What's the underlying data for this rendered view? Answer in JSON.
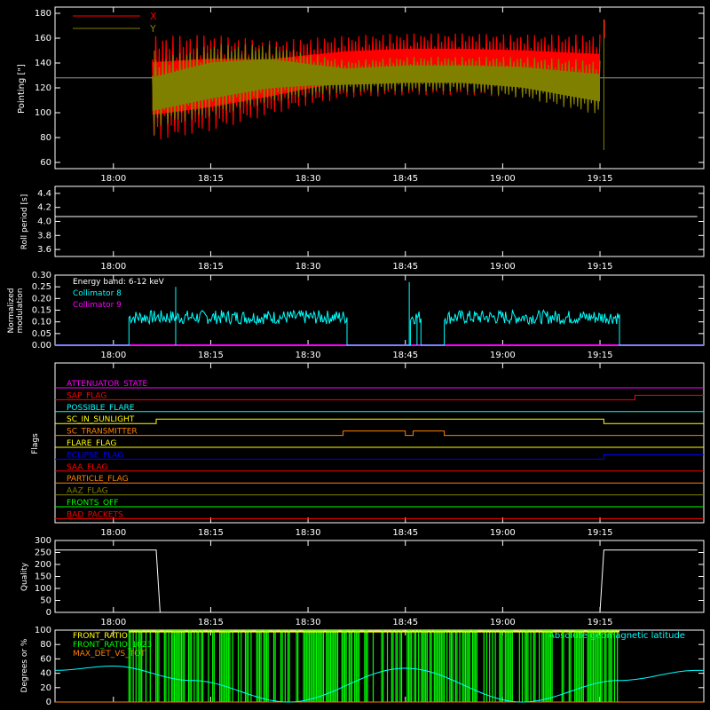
{
  "colors": {
    "background": "#000000",
    "axis": "#ffffff",
    "x_series": "#ff0000",
    "y_series": "#808000",
    "cyan": "#00ffff",
    "magenta": "#ff00ff",
    "green": "#00ff00",
    "orange": "#ff8000",
    "yellow": "#ffff00",
    "blue": "#0000ff",
    "red": "#ff0000",
    "olive": "#808000"
  },
  "chart_data": [
    {
      "id": "pointing",
      "type": "line",
      "ylabel": "Pointing [\"]",
      "ylim": [
        55,
        185
      ],
      "yticks": [
        60,
        80,
        100,
        120,
        140,
        160,
        180
      ],
      "xlim": [
        "17:51",
        "19:31"
      ],
      "xticks": [
        "18:00",
        "18:15",
        "18:30",
        "18:45",
        "19:00",
        "19:15"
      ],
      "reference_level": 128,
      "series": [
        {
          "name": "X",
          "color": "#ff0000",
          "upper": [
            [
              18.1,
              162
            ],
            [
              18.25,
              163
            ],
            [
              18.4,
              158
            ],
            [
              18.5,
              160
            ],
            [
              18.6,
              162
            ],
            [
              18.75,
              164
            ],
            [
              18.9,
              164
            ],
            [
              19.05,
              163
            ],
            [
              19.25,
              163
            ]
          ],
          "lower": [
            [
              18.1,
              77
            ],
            [
              18.25,
              85
            ],
            [
              18.4,
              98
            ],
            [
              18.5,
              106
            ],
            [
              18.6,
              112
            ],
            [
              18.75,
              114
            ],
            [
              18.9,
              114
            ],
            [
              19.05,
              112
            ],
            [
              19.25,
              100
            ]
          ]
        },
        {
          "name": "Y",
          "color": "#808000",
          "upper": [
            [
              18.1,
              142
            ],
            [
              18.25,
              155
            ],
            [
              18.4,
              155
            ],
            [
              18.5,
              148
            ],
            [
              18.6,
              142
            ],
            [
              18.75,
              145
            ],
            [
              18.9,
              145
            ],
            [
              19.05,
              145
            ],
            [
              19.25,
              142
            ]
          ],
          "lower": [
            [
              18.1,
              88
            ],
            [
              18.25,
              97
            ],
            [
              18.4,
              108
            ],
            [
              18.5,
              113
            ],
            [
              18.6,
              116
            ],
            [
              18.75,
              117
            ],
            [
              18.9,
              117
            ],
            [
              19.05,
              112
            ],
            [
              19.25,
              98
            ]
          ]
        }
      ]
    },
    {
      "id": "roll",
      "type": "line",
      "ylabel": "Roll period [s]",
      "ylim": [
        3.5,
        4.5
      ],
      "yticks": [
        3.6,
        3.8,
        4.0,
        4.2,
        4.4
      ],
      "series": [
        {
          "points": [
            [
              17.85,
              3.5
            ],
            [
              17.85,
              4.07
            ],
            [
              19.5,
              4.07
            ]
          ]
        }
      ]
    },
    {
      "id": "modulation",
      "type": "line",
      "ylabel": "Normalized modulation",
      "ylim": [
        0,
        0.3
      ],
      "yticks": [
        0.0,
        0.05,
        0.1,
        0.15,
        0.2,
        0.25,
        0.3
      ],
      "legend": [
        "Energy band: 6-12 keV",
        "Collimator 8",
        "Collimator 9"
      ],
      "segments": [
        {
          "start": 18.04,
          "end": 18.6,
          "level": 0.12
        },
        {
          "start": 18.763,
          "end": 18.79,
          "level": 0.12
        },
        {
          "start": 18.85,
          "end": 19.3,
          "level": 0.12
        }
      ],
      "spikes": [
        [
          18.16,
          0.25
        ],
        [
          18.76,
          0.27
        ],
        [
          18.78,
          0.12
        ]
      ]
    },
    {
      "id": "flags",
      "type": "line",
      "ylabel": "Flags",
      "rows": [
        {
          "label": "ATTENUATOR_STATE",
          "color": "#ff00ff",
          "transitions": []
        },
        {
          "label": "SAP_FLAG",
          "color": "#ff0000",
          "transitions": [
            [
              19.34,
              1
            ]
          ]
        },
        {
          "label": "POSSIBLE_FLARE",
          "color": "#00ffff",
          "transitions": []
        },
        {
          "label": "SC_IN_SUNLIGHT",
          "color": "#ffff00",
          "transitions": [
            [
              18.11,
              1
            ],
            [
              19.26,
              0
            ]
          ]
        },
        {
          "label": "SC_TRANSMITTER",
          "color": "#ff8000",
          "transitions": [
            [
              18.59,
              1
            ],
            [
              18.75,
              0
            ],
            [
              18.77,
              1
            ],
            [
              18.85,
              0
            ]
          ]
        },
        {
          "label": "FLARE_FLAG",
          "color": "#ffff00",
          "transitions": []
        },
        {
          "label": "ECLIPSE_FLAG",
          "color": "#0000ff",
          "transitions": [
            [
              18.11,
              0
            ],
            [
              19.26,
              1
            ]
          ]
        },
        {
          "label": "SAA_FLAG",
          "color": "#ff0000",
          "transitions": []
        },
        {
          "label": "PARTICLE_FLAG",
          "color": "#ff8000",
          "transitions": []
        },
        {
          "label": "AAZ_FLAG",
          "color": "#808000",
          "transitions": []
        },
        {
          "label": "FRONTS_OFF",
          "color": "#00ff00",
          "transitions": []
        },
        {
          "label": "BAD_PACKETS",
          "color": "#ff0000",
          "transitions": []
        }
      ]
    },
    {
      "id": "quality",
      "type": "line",
      "ylabel": "Quality",
      "ylim": [
        0,
        300
      ],
      "yticks": [
        0,
        50,
        100,
        150,
        200,
        250,
        300
      ],
      "series": [
        {
          "points": [
            [
              17.85,
              0
            ],
            [
              17.85,
              260
            ],
            [
              18.11,
              260
            ],
            [
              18.12,
              0
            ],
            [
              19.25,
              0
            ],
            [
              19.26,
              260
            ],
            [
              19.5,
              260
            ]
          ]
        }
      ]
    },
    {
      "id": "ratios",
      "type": "line",
      "ylabel": "Degrees or %",
      "ylim": [
        0,
        100
      ],
      "yticks": [
        0,
        20,
        40,
        60,
        80,
        100
      ],
      "legend": [
        "FRONT_RATIO",
        "FRONT_RATIO_1023",
        "MAX_DET_VS_TOT"
      ],
      "right_label": "Absolute geomagnetic latitude",
      "latitude": [
        [
          17.85,
          44
        ],
        [
          18.0,
          50
        ],
        [
          18.2,
          30
        ],
        [
          18.45,
          0
        ],
        [
          18.75,
          47
        ],
        [
          19.05,
          0
        ],
        [
          19.3,
          30
        ],
        [
          19.5,
          44
        ]
      ],
      "green_band": [
        18.04,
        19.3
      ]
    }
  ],
  "labels": {
    "pointing_legend_x": "X",
    "pointing_legend_y": "Y",
    "pointing_ylabel": "Pointing [\"]",
    "roll_ylabel": "Roll period [s]",
    "mod_ylabel1": "Normalized",
    "mod_ylabel2": "modulation",
    "mod_legend_0": "Energy band: 6-12 keV",
    "mod_legend_1": "Collimator 8",
    "mod_legend_2": "Collimator 9",
    "flags_ylabel": "Flags",
    "quality_ylabel": "Quality",
    "ratio_ylabel": "Degrees or %",
    "ratio_legend_0": "FRONT_RATIO",
    "ratio_legend_1": "FRONT_RATIO_1023",
    "ratio_legend_2": "MAX_DET_VS_TOT",
    "ratio_right": "Absolute geomagnetic latitude"
  }
}
